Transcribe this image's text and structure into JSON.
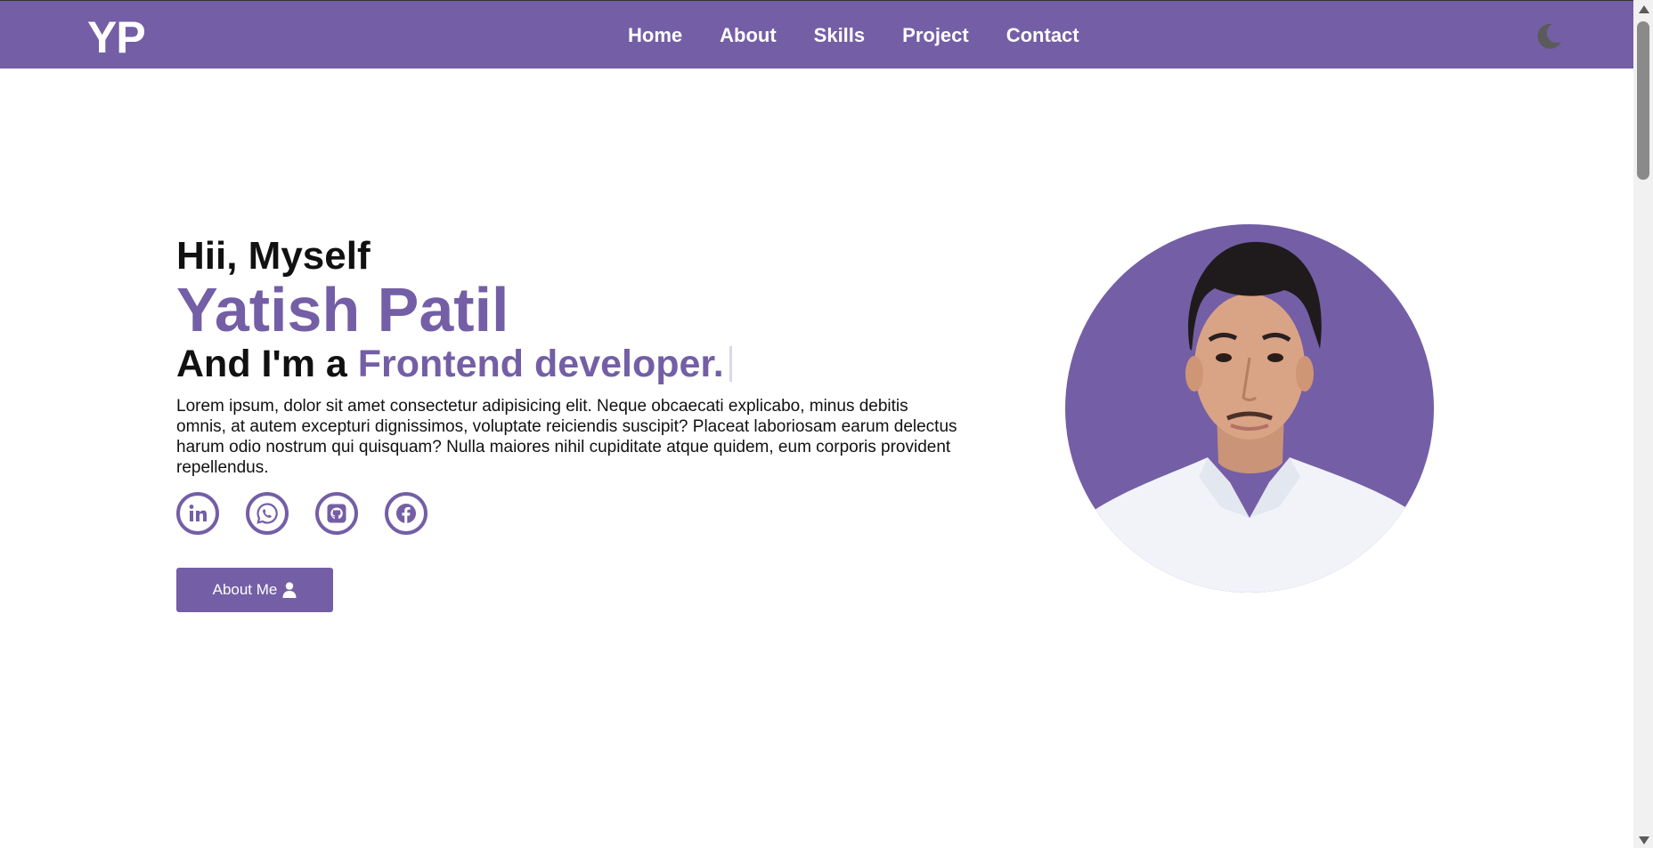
{
  "header": {
    "logo": "YP",
    "nav": [
      "Home",
      "About",
      "Skills",
      "Project",
      "Contact"
    ],
    "theme_icon": "moon-icon"
  },
  "hero": {
    "greeting": "Hii, Myself",
    "name": "Yatish Patil",
    "role_prefix": "And I'm a",
    "role": "Frontend developer.",
    "intro": "Lorem ipsum, dolor sit amet consectetur adipisicing elit. Neque obcaecati explicabo, minus debitis omnis, at autem excepturi dignissimos, voluptate reiciendis suscipit? Placeat laboriosam earum delectus harum odio nostrum qui quisquam? Nulla maiores nihil cupiditate atque quidem, eum corporis provident repellendus.",
    "social_icons": [
      "linkedin-icon",
      "whatsapp-icon",
      "github-icon",
      "facebook-icon"
    ],
    "button_label": "About Me",
    "button_icon": "user-icon"
  },
  "colors": {
    "accent": "#745ea6",
    "text": "#111111",
    "background": "#ffffff"
  }
}
